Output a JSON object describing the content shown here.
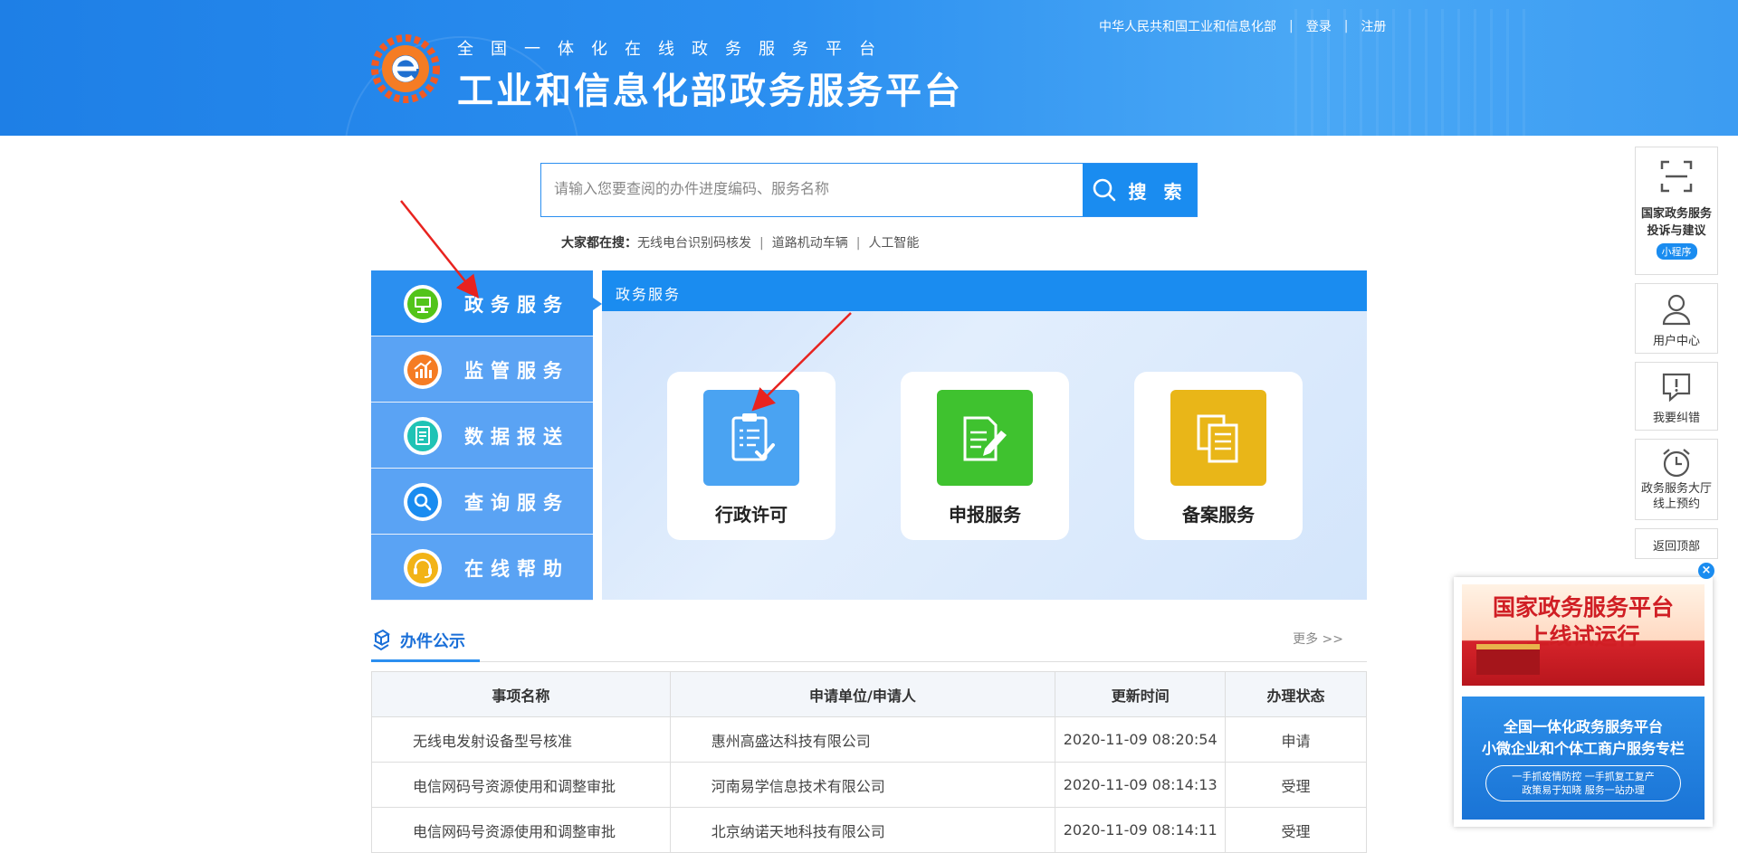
{
  "header": {
    "subtitle": "全国一体化在线政务服务平台",
    "title": "工业和信息化部政务服务平台",
    "links": {
      "ministry": "中华人民共和国工业和信息化部",
      "login": "登录",
      "register": "注册"
    }
  },
  "search": {
    "placeholder": "请输入您要查阅的办件进度编码、服务名称",
    "button_label": "搜 索",
    "hot_label": "大家都在搜：",
    "hot_items": [
      "无线电台识别码核发",
      "道路机动车辆",
      "人工智能"
    ]
  },
  "left_nav": [
    {
      "label": "政务服务",
      "active": true,
      "icon": "monitor-icon",
      "color": "#52c41a"
    },
    {
      "label": "监管服务",
      "active": false,
      "icon": "chart-icon",
      "color": "#f57c24"
    },
    {
      "label": "数据报送",
      "active": false,
      "icon": "document-icon",
      "color": "#1fc3b5"
    },
    {
      "label": "查询服务",
      "active": false,
      "icon": "search-icon",
      "color": "#1a8cf0"
    },
    {
      "label": "在线帮助",
      "active": false,
      "icon": "headset-icon",
      "color": "#f2b317"
    }
  ],
  "panel": {
    "title": "政务服务",
    "services": [
      {
        "label": "行政许可",
        "color": "#4aa3f2",
        "icon": "clipboard-icon"
      },
      {
        "label": "申报服务",
        "color": "#3fc22f",
        "icon": "edit-document-icon"
      },
      {
        "label": "备案服务",
        "color": "#e9b618",
        "icon": "copy-document-icon"
      }
    ]
  },
  "publicity": {
    "title": "办件公示",
    "more": "更多 >>",
    "columns": [
      "事项名称",
      "申请单位/申请人",
      "更新时间",
      "办理状态"
    ],
    "rows": [
      [
        "无线电发射设备型号核准",
        "惠州高盛达科技有限公司",
        "2020-11-09 08:20:54",
        "申请"
      ],
      [
        "电信网码号资源使用和调整审批",
        "河南易学信息技术有限公司",
        "2020-11-09 08:14:13",
        "受理"
      ],
      [
        "电信网码号资源使用和调整审批",
        "北京纳诺天地科技有限公司",
        "2020-11-09 08:14:11",
        "受理"
      ]
    ]
  },
  "float_bar": {
    "miniapp_line1": "国家政务服务",
    "miniapp_line2": "投诉与建议",
    "miniapp_badge": "小程序",
    "user_center": "用户中心",
    "correction": "我要纠错",
    "appointment_line1": "政务服务大厅",
    "appointment_line2": "线上预约",
    "back_top": "返回顶部"
  },
  "ad": {
    "close": "×",
    "top_line1": "国家政务服务平台",
    "top_line2": "上线试运行",
    "bottom_line1": "全国一体化政务服务平台",
    "bottom_line2": "小微企业和个体工商户服务专栏",
    "pill_line1": "一手抓疫情防控 一手抓复工复产",
    "pill_line2": "政策易于知晓 服务一站办理"
  },
  "colors": {
    "primary": "#1a8cf0",
    "nav_bg": "#5aa3f4",
    "nav_active": "#2b8ff0",
    "annotation": "#e8231f"
  }
}
